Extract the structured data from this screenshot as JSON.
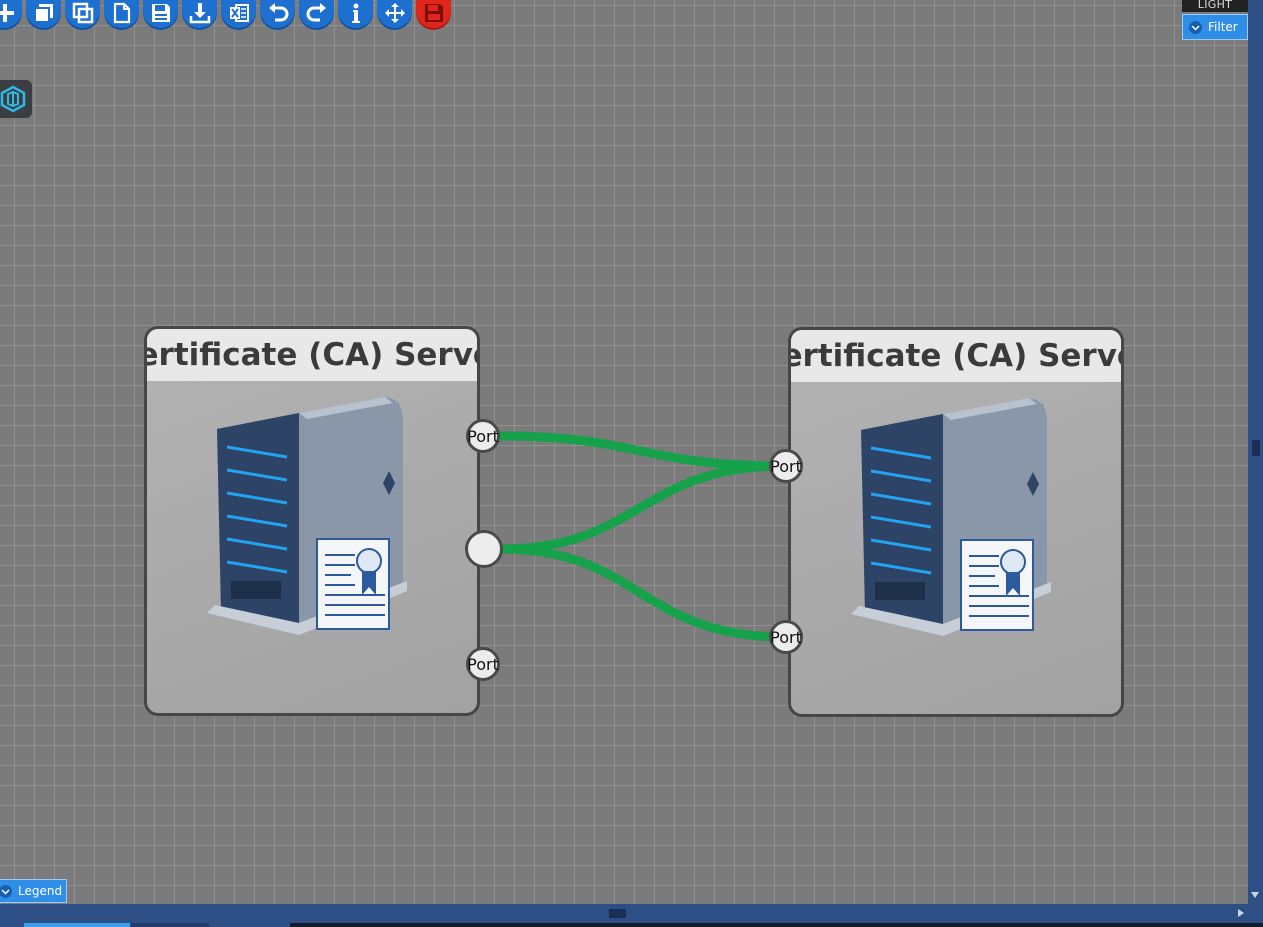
{
  "toolbar": {
    "buttons": [
      {
        "icon": "plus-icon"
      },
      {
        "icon": "stack-icon"
      },
      {
        "icon": "copy-icon"
      },
      {
        "icon": "new-document-icon"
      },
      {
        "icon": "save-icon"
      },
      {
        "icon": "download-icon"
      },
      {
        "icon": "excel-icon"
      },
      {
        "icon": "undo-icon"
      },
      {
        "icon": "redo-icon"
      },
      {
        "icon": "info-icon"
      },
      {
        "icon": "move-icon"
      },
      {
        "icon": "delete-save-icon",
        "color": "#e1251b"
      }
    ]
  },
  "theme": {
    "label": "LIGHT"
  },
  "filter": {
    "label": "Filter"
  },
  "legend": {
    "label": "Legend"
  },
  "diagram": {
    "nodes": [
      {
        "title": "Certificate (CA) Server",
        "icon": "certificate-server-icon"
      },
      {
        "title": "Certificate (CA) Server",
        "icon": "certificate-server-icon"
      }
    ],
    "ports": {
      "left_top": "Port",
      "left_middle": "",
      "left_bottom": "Port",
      "right_top": "Port",
      "right_bottom": "Port"
    },
    "wire_color": "#15a24a"
  },
  "colors": {
    "canvas": "#7b7b7b",
    "accent": "#2e8ee8",
    "scrollbar": "#2d4f86"
  }
}
